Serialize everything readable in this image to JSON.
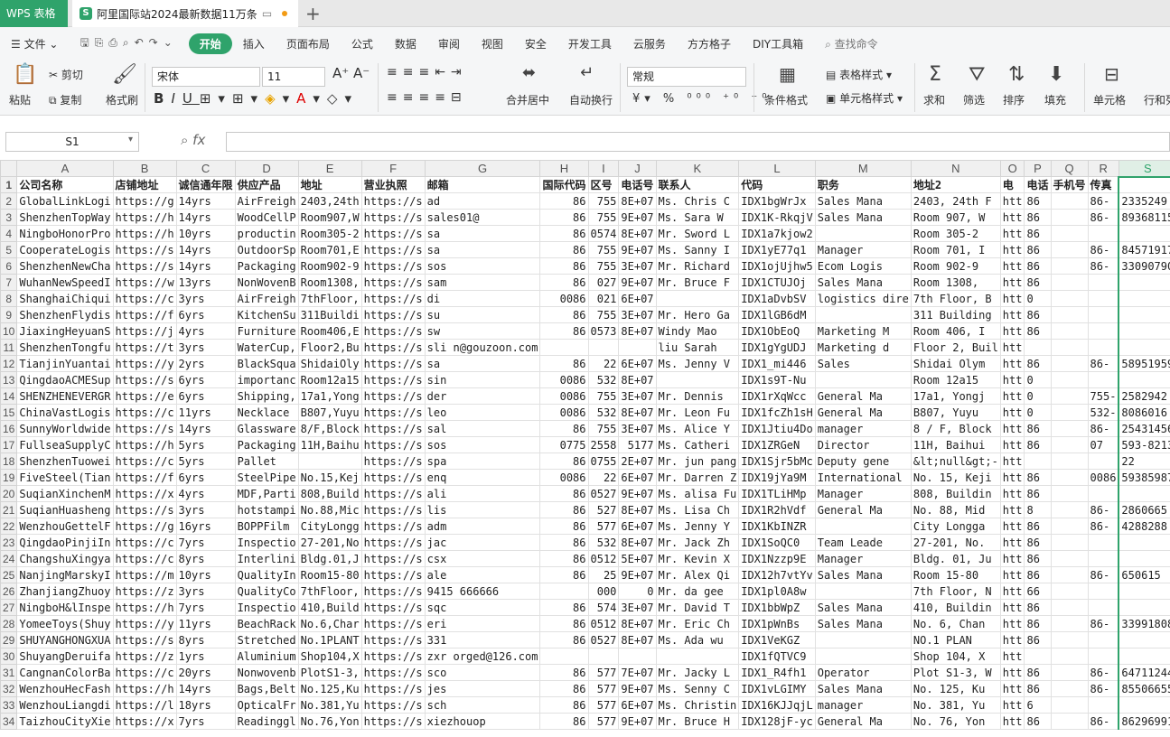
{
  "app": {
    "name": "WPS 表格"
  },
  "doc_tab": {
    "icon": "S",
    "title": "阿里国际站2024最新数据11万条"
  },
  "menu": [
    "文件",
    "开始",
    "插入",
    "页面布局",
    "公式",
    "数据",
    "审阅",
    "视图",
    "安全",
    "开发工具",
    "云服务",
    "方方格子",
    "DIY工具箱",
    "查找命令"
  ],
  "ribbon": {
    "paste": "粘贴",
    "cut": "剪切",
    "copy": "复制",
    "format_painter": "格式刷",
    "font_name": "宋体",
    "font_size": "11",
    "merge": "合并居中",
    "wrap": "自动换行",
    "number_format": "常规",
    "table_style": "表格样式",
    "cond_format": "条件格式",
    "cell_style": "单元格样式",
    "sum": "求和",
    "filter": "筛选",
    "sort": "排序",
    "fill": "填充",
    "cell": "单元格",
    "rowcol": "行和列"
  },
  "name_box": "S1",
  "columns": [
    "A",
    "B",
    "C",
    "D",
    "E",
    "F",
    "G",
    "H",
    "I",
    "J",
    "K",
    "L",
    "M",
    "N",
    "O",
    "P",
    "Q",
    "R",
    "S"
  ],
  "header_row": [
    "公司名称",
    "店铺地址",
    "诚信通年限",
    "供应产品",
    "地址",
    "营业执照",
    "邮箱",
    "国际代码",
    "区号",
    "电话号",
    "联系人",
    "代码",
    "职务",
    "地址2",
    "电",
    "电话",
    "手机号",
    "传真",
    ""
  ],
  "rows": [
    [
      "GlobalLinkLogi",
      "https://g",
      "14yrs",
      "AirFreigh",
      "2403,24th",
      "https://s",
      "ad",
      "86",
      "755",
      "8E+07",
      "Ms. Chris C",
      "IDX1bgWrJx",
      "Sales Mana",
      "2403, 24th F",
      "htt",
      "86",
      "",
      "86-",
      "2335249"
    ],
    [
      "ShenzhenTopWay",
      "https://h",
      "14yrs",
      "WoodCellP",
      "Room907,W",
      "https://s",
      "sales01@",
      "86",
      "755",
      "9E+07",
      "Ms. Sara W",
      "IDX1K-RkqjV",
      "Sales Mana",
      "Room 907, W",
      "htt",
      "86",
      "",
      "86-",
      "89368115"
    ],
    [
      "NingboHonorPro",
      "https://h",
      "10yrs",
      "productin",
      "Room305-2",
      "https://s",
      "sa",
      "86",
      "0574",
      "8E+07",
      "Mr. Sword L",
      "IDX1a7kjow2",
      "",
      "Room 305-2",
      "htt",
      "86",
      "",
      "",
      ""
    ],
    [
      "CooperateLogis",
      "https://s",
      "14yrs",
      "OutdoorSp",
      "Room701,E",
      "https://s",
      "sa",
      "86",
      "755",
      "9E+07",
      "Ms. Sanny I",
      "IDX1yE77q1",
      "Manager",
      "Room 701, I",
      "htt",
      "86",
      "",
      "86-",
      "84571917"
    ],
    [
      "ShenzhenNewCha",
      "https://s",
      "14yrs",
      "Packaging",
      "Room902-9",
      "https://s",
      "sos",
      "86",
      "755",
      "3E+07",
      "Mr. Richard",
      "IDX1ojUjhw5",
      "Ecom Logis",
      "Room 902-9",
      "htt",
      "86",
      "",
      "86-",
      "33090790"
    ],
    [
      "WuhanNewSpeedI",
      "https://w",
      "13yrs",
      "NonWovenB",
      "Room1308,",
      "https://s",
      "sam",
      "86",
      "027",
      "9E+07",
      "Mr. Bruce F",
      "IDX1CTUJOj",
      "Sales Mana",
      "Room 1308,",
      "htt",
      "86",
      "",
      "",
      ""
    ],
    [
      "ShanghaiChiqui",
      "https://c",
      "3yrs",
      "AirFreigh",
      "7thFloor,",
      "https://s",
      "di",
      "0086",
      "021",
      "6E+07",
      "",
      "IDX1aDvbSV",
      "logistics dire",
      "7th Floor, B",
      "htt",
      "0",
      "",
      "",
      ""
    ],
    [
      "ShenzhenFlydis",
      "https://f",
      "6yrs",
      "KitchenSu",
      "311Buildi",
      "https://s",
      "su",
      "86",
      "755",
      "3E+07",
      "Mr. Hero Ga",
      "IDX1lGB6dM",
      "",
      "311 Building",
      "htt",
      "86",
      "",
      "",
      ""
    ],
    [
      "JiaxingHeyuanS",
      "https://j",
      "4yrs",
      "Furniture",
      "Room406,E",
      "https://s",
      "sw",
      "86",
      "0573",
      "8E+07",
      "Windy Mao",
      "IDX1ObEoQ",
      "Marketing M",
      "Room 406, I",
      "htt",
      "86",
      "",
      "",
      ""
    ],
    [
      "ShenzhenTongfu",
      "https://t",
      "3yrs",
      "WaterCup,",
      "Floor2,Bu",
      "https://s",
      "sli  n@gouzoon.com",
      "",
      "",
      "",
      "liu Sarah",
      "IDX1gYgUDJ",
      "Marketing d",
      "Floor 2, Buil",
      "htt",
      "",
      "",
      "",
      ""
    ],
    [
      "TianjinYuantai",
      "https://y",
      "2yrs",
      "BlackSqua",
      "ShidaiOly",
      "https://s",
      "sa",
      "86",
      "22",
      "6E+07",
      "Ms. Jenny V",
      "IDX1_mi446",
      "Sales",
      "Shidai Olym",
      "htt",
      "86",
      "",
      "86-",
      "58951959"
    ],
    [
      "QingdaoACMESup",
      "https://s",
      "6yrs",
      "importanc",
      "Room12a15",
      "https://s",
      "sin",
      "0086",
      "532",
      "8E+07",
      "",
      "IDX1s9T-Nu",
      "",
      "Room 12a15",
      "htt",
      "0",
      "",
      "",
      ""
    ],
    [
      "SHENZHENEVERGR",
      "https://e",
      "6yrs",
      "Shipping,",
      "17a1,Yong",
      "https://s",
      "der",
      "0086",
      "755",
      "3E+07",
      "Mr. Dennis",
      "IDX1rXqWcc",
      "General Ma",
      "17a1, Yongj",
      "htt",
      "0",
      "",
      "755-",
      "2582942"
    ],
    [
      "ChinaVastLogis",
      "https://c",
      "11yrs",
      "Necklace",
      "B807,Yuyu",
      "https://s",
      "leo",
      "0086",
      "532",
      "8E+07",
      "Mr. Leon Fu",
      "IDX1fcZh1sH",
      "General Ma",
      "B807, Yuyu",
      "htt",
      "0",
      "",
      "532-",
      "8086016"
    ],
    [
      "SunnyWorldwide",
      "https://s",
      "14yrs",
      "Glassware",
      "8/F,Block",
      "https://s",
      "sal",
      "86",
      "755",
      "3E+07",
      "Ms. Alice Y",
      "IDX1Jtiu4Do",
      "manager",
      "8 / F, Block",
      "htt",
      "86",
      "",
      "86-",
      "25431456"
    ],
    [
      "FullseaSupplyC",
      "https://h",
      "5yrs",
      "Packaging",
      "11H,Baihu",
      "https://s",
      "sos",
      "0775",
      "2558",
      "5177",
      "Ms. Catheri",
      "IDX1ZRGeN",
      "Director",
      "11H, Baihui",
      "htt",
      "86",
      "",
      "07",
      "593-8213"
    ],
    [
      "ShenzhenTuowei",
      "https://c",
      "5yrs",
      "Pallet",
      "",
      "https://s",
      "spa",
      "86",
      "0755",
      "2E+07",
      "Mr. jun pang",
      "IDX1Sjr5bMc",
      "Deputy gene",
      "&lt;null&gt;-",
      "htt",
      "",
      "",
      "",
      "22"
    ],
    [
      "FiveSteel(Tian",
      "https://f",
      "6yrs",
      "SteelPipe",
      "No.15,Kej",
      "https://s",
      "enq",
      "0086",
      "22",
      "6E+07",
      "Mr. Darren Z",
      "IDX19jYa9M",
      "International",
      "No. 15, Keji",
      "htt",
      "86",
      "",
      "0086",
      "59385987"
    ],
    [
      "SuqianXinchenM",
      "https://x",
      "4yrs",
      "MDF,Parti",
      "808,Build",
      "https://s",
      "ali",
      "86",
      "0527",
      "9E+07",
      "Ms. alisa Fu",
      "IDX1TLiHMp",
      "Manager",
      "808, Buildin",
      "htt",
      "86",
      "",
      "",
      ""
    ],
    [
      "SuqianHuasheng",
      "https://s",
      "3yrs",
      "hotstampi",
      "No.88,Mic",
      "https://s",
      "lis",
      "86",
      "527",
      "8E+07",
      "Ms. Lisa Ch",
      "IDX1R2hVdf",
      "General Ma",
      "No. 88, Mid",
      "htt",
      "8",
      "",
      "86-",
      "2860665"
    ],
    [
      "WenzhouGettelF",
      "https://g",
      "16yrs",
      "BOPPFilm",
      "CityLongg",
      "https://s",
      "adm",
      "86",
      "577",
      "6E+07",
      "Ms. Jenny Y",
      "IDX1KbINZR",
      "",
      "City Longga",
      "htt",
      "86",
      "",
      "86-",
      "4288288"
    ],
    [
      "QingdaoPinjiIn",
      "https://c",
      "7yrs",
      "Inspectio",
      "27-201,No",
      "https://s",
      "jac",
      "86",
      "532",
      "8E+07",
      "Mr. Jack Zh",
      "IDX1SoQC0",
      "Team Leade",
      "27-201, No.",
      "htt",
      "86",
      "",
      "",
      ""
    ],
    [
      "ChangshuXingya",
      "https://c",
      "8yrs",
      "Interlini",
      "Bldg.01,J",
      "https://s",
      "csx",
      "86",
      "0512",
      "5E+07",
      "Mr. Kevin X",
      "IDX1Nzzp9E",
      "Manager",
      "Bldg. 01, Ju",
      "htt",
      "86",
      "",
      "",
      ""
    ],
    [
      "NanjingMarskyI",
      "https://m",
      "10yrs",
      "QualityIn",
      "Room15-80",
      "https://s",
      "ale",
      "86",
      "25",
      "9E+07",
      "Mr. Alex Qi",
      "IDX12h7vtYv",
      "Sales Mana",
      "Room 15-80",
      "htt",
      "86",
      "",
      "86-",
      "650615"
    ],
    [
      "ZhanjiangZhuoy",
      "https://z",
      "3yrs",
      "QualityCo",
      "7thFloor,",
      "https://s",
      "9415  666666",
      "",
      "000",
      "0",
      "Mr. da gee",
      "IDX1pl0A8w",
      "",
      "7th Floor, N",
      "htt",
      "66",
      "",
      "",
      ""
    ],
    [
      "NingboH&lInspe",
      "https://h",
      "7yrs",
      "Inspectio",
      "410,Build",
      "https://s",
      "sqc",
      "86",
      "574",
      "3E+07",
      "Mr. David T",
      "IDX1bbWpZ",
      "Sales Mana",
      "410, Buildin",
      "htt",
      "86",
      "",
      "",
      ""
    ],
    [
      "YomeeToys(Shuy",
      "https://y",
      "11yrs",
      "BeachRack",
      "No.6,Char",
      "https://s",
      "eri",
      "86",
      "0512",
      "8E+07",
      "Mr. Eric Ch",
      "IDX1pWnBs",
      "Sales Mana",
      "No. 6, Chan",
      "htt",
      "86",
      "",
      "86-",
      "33991808"
    ],
    [
      "SHUYANGHONGXUA",
      "https://s",
      "8yrs",
      "Stretched",
      "No.1PLANT",
      "https://s",
      "331",
      "86",
      "0527",
      "8E+07",
      "Ms. Ada wu",
      "IDX1VeKGZ",
      "",
      "NO.1 PLAN",
      "htt",
      "86",
      "",
      "",
      ""
    ],
    [
      "ShuyangDeruifa",
      "https://z",
      "1yrs",
      "Aluminium",
      "Shop104,X",
      "https://s",
      "zxr  orged@126.com",
      "",
      "",
      "",
      "",
      "IDX1fQTVC9",
      "",
      "Shop 104, X",
      "htt",
      "",
      "",
      "",
      ""
    ],
    [
      "CangnanColorBa",
      "https://c",
      "20yrs",
      "Nonwovenb",
      "PlotS1-3,",
      "https://s",
      "sco",
      "86",
      "577",
      "7E+07",
      "Mr. Jacky L",
      "IDX1_R4fh1",
      "Operator",
      "Plot S1-3, W",
      "htt",
      "86",
      "",
      "86-",
      "64711244"
    ],
    [
      "WenzhouHecFash",
      "https://h",
      "14yrs",
      "Bags,Belt",
      "No.125,Ku",
      "https://s",
      "jes",
      "86",
      "577",
      "9E+07",
      "Ms. Senny C",
      "IDX1vLGIMY",
      "Sales Mana",
      "No. 125, Ku",
      "htt",
      "86",
      "",
      "86-",
      "85506655"
    ],
    [
      "WenzhouLiangdi",
      "https://l",
      "18yrs",
      "OpticalFr",
      "No.381,Yu",
      "https://s",
      "sch",
      "86",
      "577",
      "6E+07",
      "Ms. Christin",
      "IDX16KJJqjL",
      "manager",
      "No. 381, Yu",
      "htt",
      "6",
      "",
      "",
      ""
    ],
    [
      "TaizhouCityXie",
      "https://x",
      "7yrs",
      "Readinggl",
      "No.76,Yon",
      "https://s",
      "xiezhouop",
      "86",
      "577",
      "9E+07",
      "Mr. Bruce H",
      "IDX128jF-yc",
      "General Ma",
      "No. 76, Yon",
      "htt",
      "86",
      "",
      "86-",
      "86296991"
    ]
  ]
}
